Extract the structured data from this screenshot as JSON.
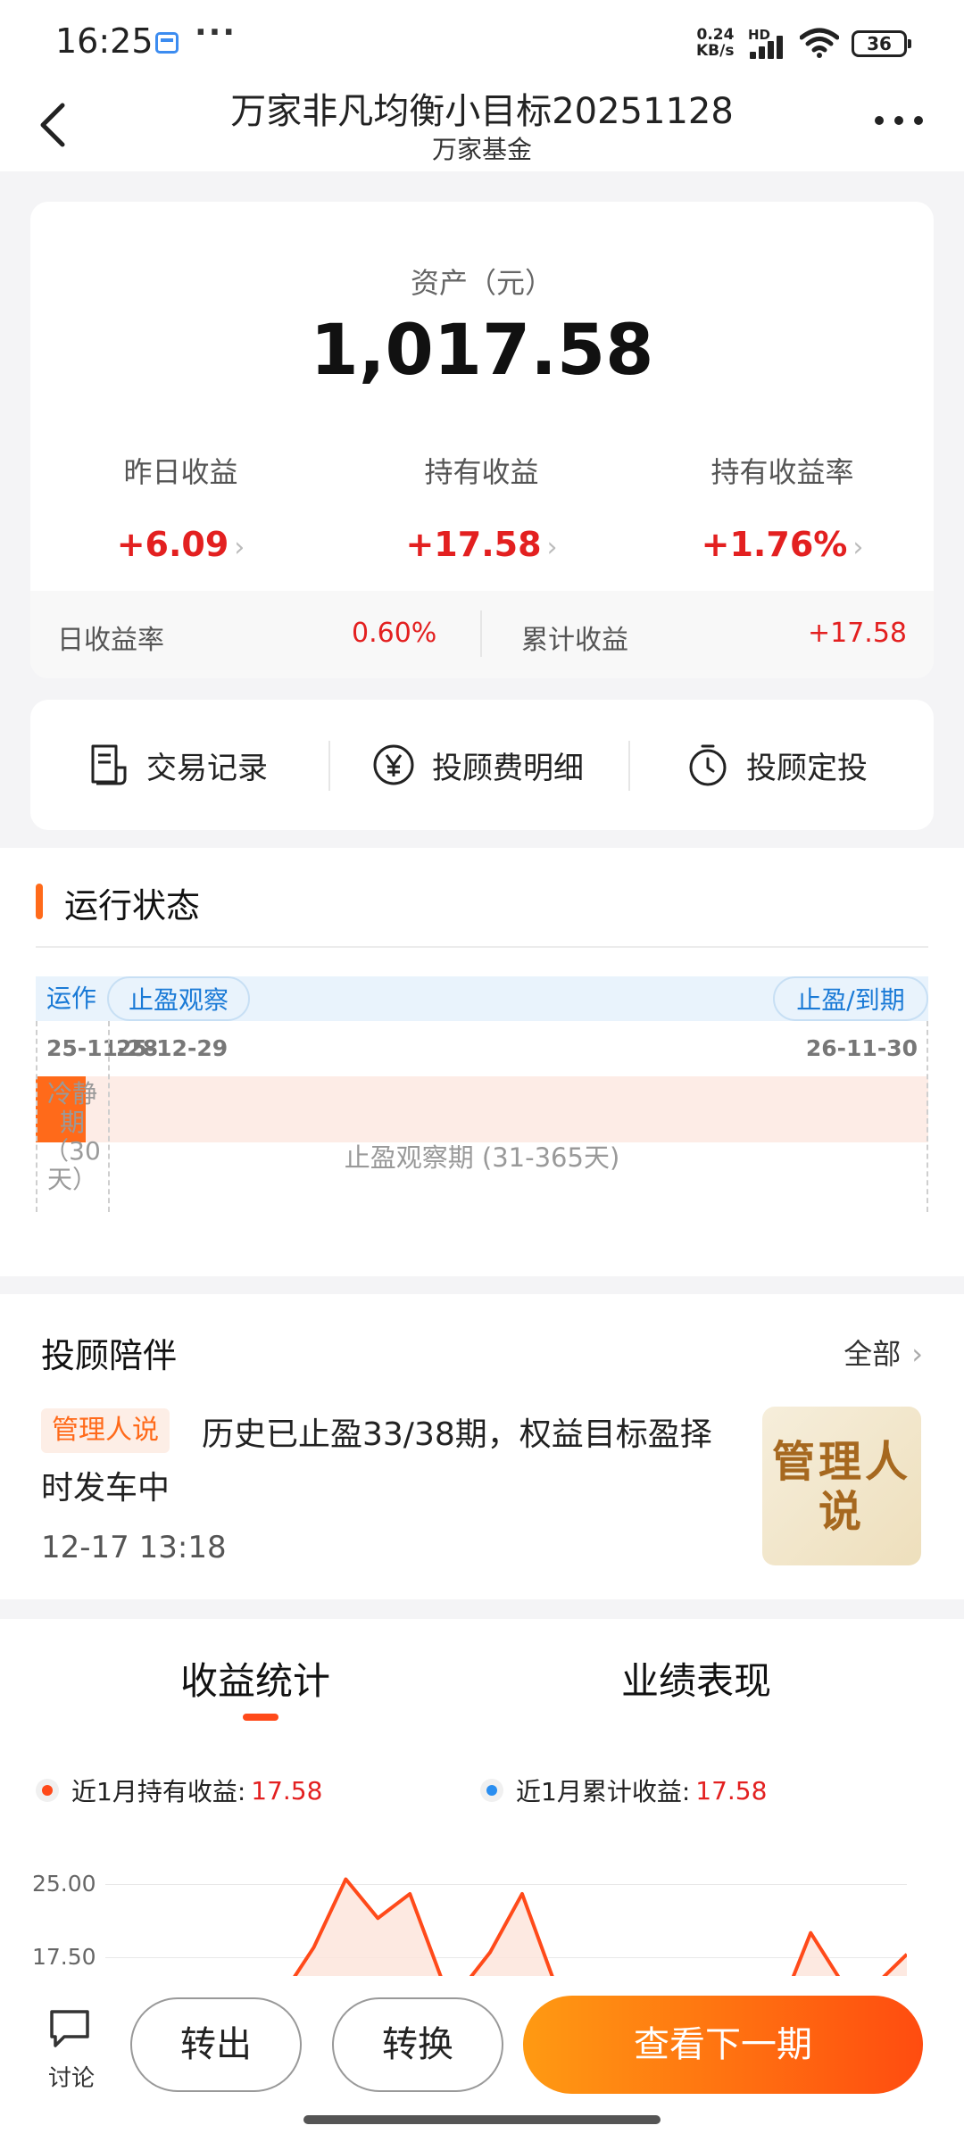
{
  "status_bar": {
    "time": "16:25",
    "more": "···",
    "net_speed": "0.24",
    "net_unit": "KB/s",
    "hd": "HD",
    "battery": "36"
  },
  "nav": {
    "title": "万家非凡均衡小目标20251128",
    "subtitle": "万家基金"
  },
  "asset": {
    "label": "资产（元）",
    "value": "1,017.58",
    "metrics": [
      {
        "label": "昨日收益",
        "value": "+6.09"
      },
      {
        "label": "持有收益",
        "value": "+17.58"
      },
      {
        "label": "持有收益率",
        "value": "+1.76%"
      }
    ],
    "daily_rate_label": "日收益率",
    "daily_rate_value": "0.60%",
    "cumulative_label": "累计收益",
    "cumulative_value": "+17.58"
  },
  "actions": [
    {
      "label": "交易记录",
      "icon": "receipt-icon"
    },
    {
      "label": "投顾费明细",
      "icon": "yen-icon"
    },
    {
      "label": "投顾定投",
      "icon": "timer-icon"
    }
  ],
  "run_status": {
    "title": "运行状态",
    "stage_running": "运作",
    "stage_observe": "止盈观察",
    "stage_end": "止盈/到期",
    "date_start": "25-11-28",
    "date_observe": "25-12-29",
    "date_end": "26-11-30",
    "cool_label": "冷静期（30天）",
    "observe_label": "止盈观察期 (31-365天)"
  },
  "companion": {
    "title": "投顾陪伴",
    "all_label": "全部",
    "tag": "管理人说",
    "text": "历史已止盈33/38期，权益目标盈择时发车中",
    "time": "12-17 13:18",
    "thumb_text": "管理人说"
  },
  "stats": {
    "tab_active": "收益统计",
    "tab_other": "业绩表现",
    "legend_hold_label": "近1月持有收益:",
    "legend_hold_value": "17.58",
    "legend_cum_label": "近1月累计收益:",
    "legend_cum_value": "17.58",
    "colors": {
      "hold": "#ff4a1a",
      "cumulative": "#2a8ef0"
    }
  },
  "chart_data": {
    "type": "area",
    "yticks": [
      "25.00",
      "17.50"
    ],
    "ylim_visible": [
      13,
      26.5
    ],
    "series": [
      {
        "points": [
          [
            0.22,
            13.5
          ],
          [
            0.26,
            18.5
          ],
          [
            0.3,
            25.5
          ],
          [
            0.34,
            21.5
          ],
          [
            0.38,
            24.0
          ],
          [
            0.42,
            15.2
          ],
          [
            0.44,
            13.8
          ],
          [
            0.48,
            18.0
          ],
          [
            0.52,
            24.0
          ],
          [
            0.56,
            15.0
          ],
          [
            0.6,
            13.6
          ],
          [
            0.85,
            13.8
          ],
          [
            0.88,
            20.0
          ],
          [
            0.92,
            14.8
          ],
          [
            0.95,
            13.8
          ],
          [
            1.0,
            17.8
          ]
        ]
      }
    ]
  },
  "bottom": {
    "discuss": "讨论",
    "transfer_out": "转出",
    "convert": "转换",
    "next_period": "查看下一期"
  }
}
